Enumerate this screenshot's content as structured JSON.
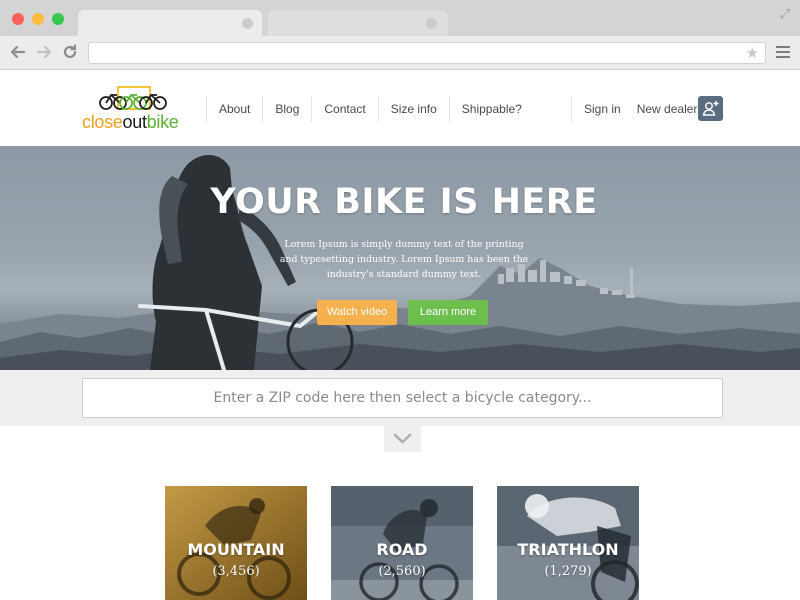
{
  "browser": {
    "tabs": [
      {
        "label": ""
      },
      {
        "label": ""
      }
    ],
    "url": ""
  },
  "logo": {
    "part1": "close",
    "part2": "out",
    "part3": "bike"
  },
  "nav": {
    "items": [
      "About",
      "Blog",
      "Contact",
      "Size info",
      "Shippable?"
    ],
    "sign_in": "Sign in",
    "new_dealer": "New dealer"
  },
  "hero": {
    "title": "YOUR BIKE IS HERE",
    "subtitle": "Lorem Ipsum is simply dummy text of the printing and typesetting industry. Lorem Ipsum has been the industry's standard dummy text.",
    "watch_video": "Watch video",
    "learn_more": "Learn more"
  },
  "search": {
    "placeholder": "Enter a ZIP code here then select a bicycle category..."
  },
  "categories": [
    {
      "name": "MOUNTAIN",
      "count": "(3,456)"
    },
    {
      "name": "ROAD",
      "count": "(2,560)"
    },
    {
      "name": "TRIATHLON",
      "count": "(1,279)"
    }
  ],
  "colors": {
    "accent_orange": "#f6b14d",
    "accent_green": "#6cbf4c",
    "logo_orange": "#f0a01d",
    "logo_green": "#5ab031",
    "dealer_button": "#5a6d80"
  },
  "icons": {
    "browser": [
      "close-dot",
      "minimize-dot",
      "maximize-dot",
      "back-arrow-icon",
      "forward-arrow-icon",
      "reload-icon",
      "star-icon",
      "menu-icon",
      "fullscreen-icon"
    ],
    "site": [
      "bicycles-logo-icon",
      "add-user-icon",
      "chevron-down-icon"
    ]
  }
}
